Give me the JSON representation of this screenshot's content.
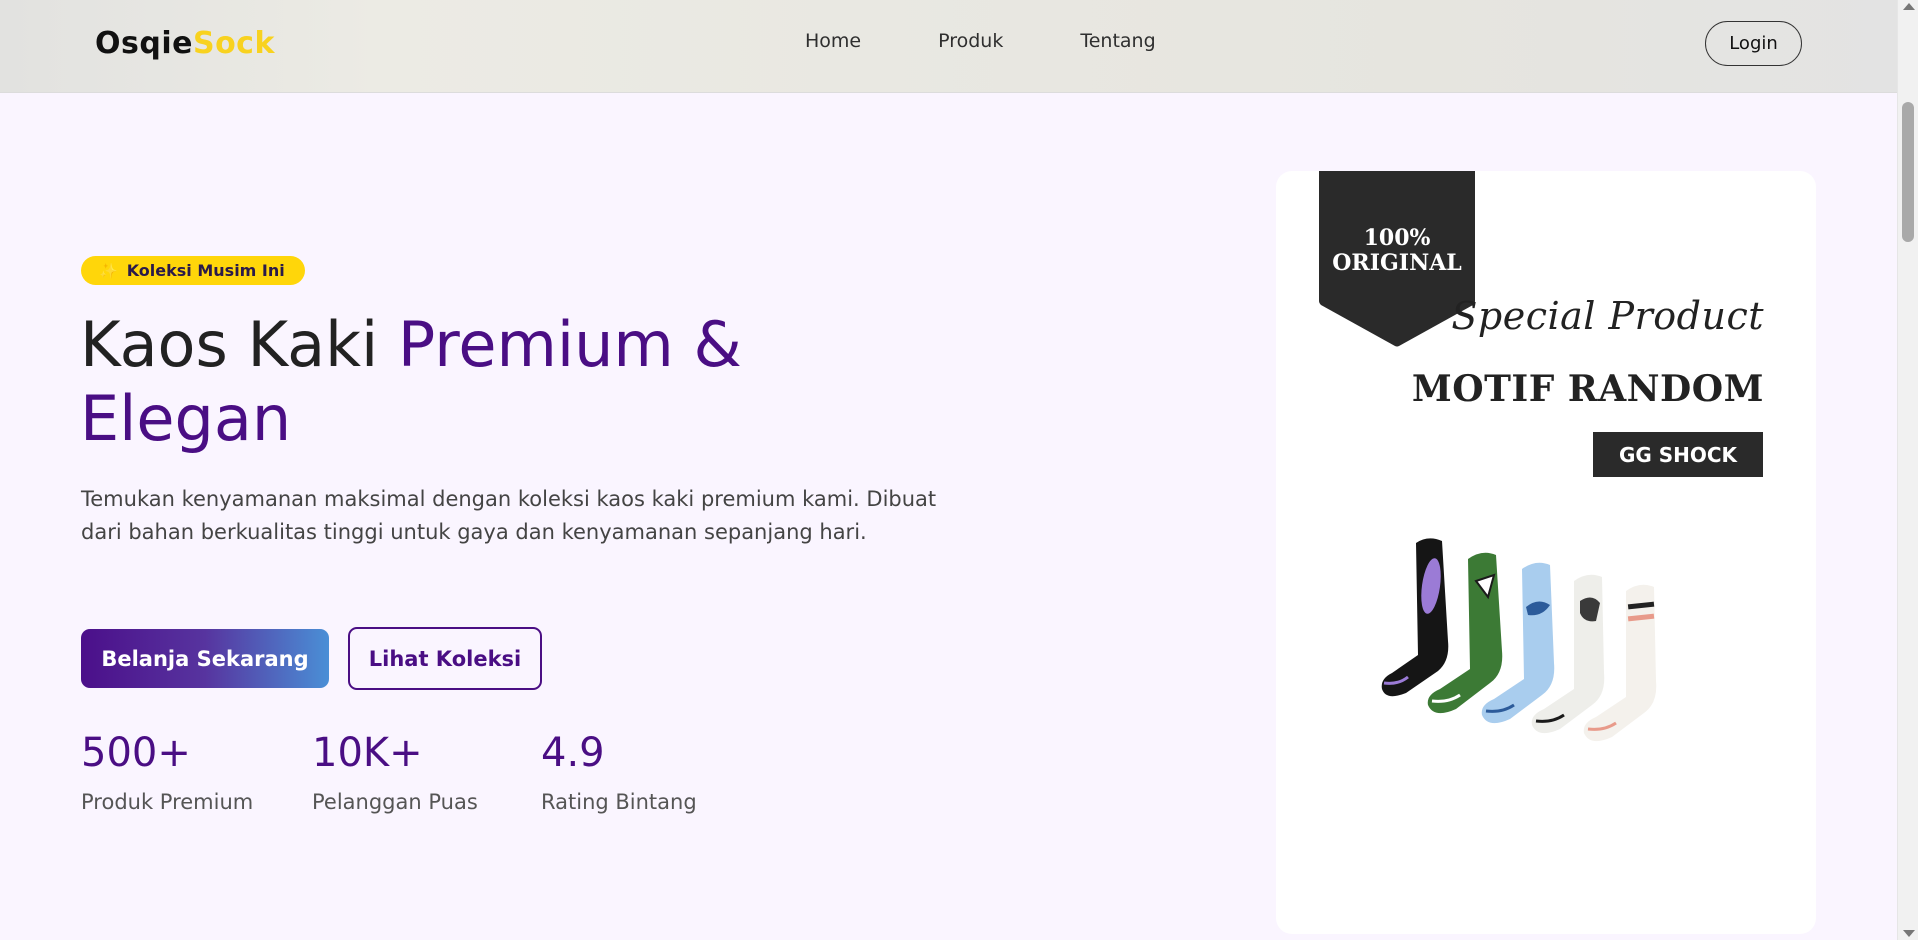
{
  "header": {
    "brand_part1": "Osqie",
    "brand_part2": "Sock",
    "nav": [
      "Home",
      "Produk",
      "Tentang"
    ],
    "login_label": "Login"
  },
  "hero": {
    "badge_icon": "sparkles-icon",
    "badge": "Koleksi Musim Ini",
    "title_part1": "Kaos Kaki ",
    "title_part2": "Premium & Elegan",
    "description": "Temukan kenyamanan maksimal dengan koleksi kaos kaki premium kami. Dibuat dari bahan berkualitas tinggi untuk gaya dan kenyamanan sepanjang hari.",
    "primary_button": "Belanja Sekarang",
    "secondary_button": "Lihat Koleksi",
    "stats": [
      {
        "value": "500+",
        "label": "Produk Premium"
      },
      {
        "value": "10K+",
        "label": "Pelanggan Puas"
      },
      {
        "value": "4.9",
        "label": "Rating Bintang"
      }
    ]
  },
  "product_card": {
    "ribbon_line1": "100%",
    "ribbon_line2": "ORIGINAL",
    "script_heading": "Special Product",
    "heading": "MOTIF RANDOM",
    "brand_tag": "GG SHOCK"
  },
  "colors": {
    "accent": "#4a0e84",
    "highlight": "#ffd60a",
    "background": "#faf5ff",
    "gradient_end": "#4a8fd6"
  }
}
